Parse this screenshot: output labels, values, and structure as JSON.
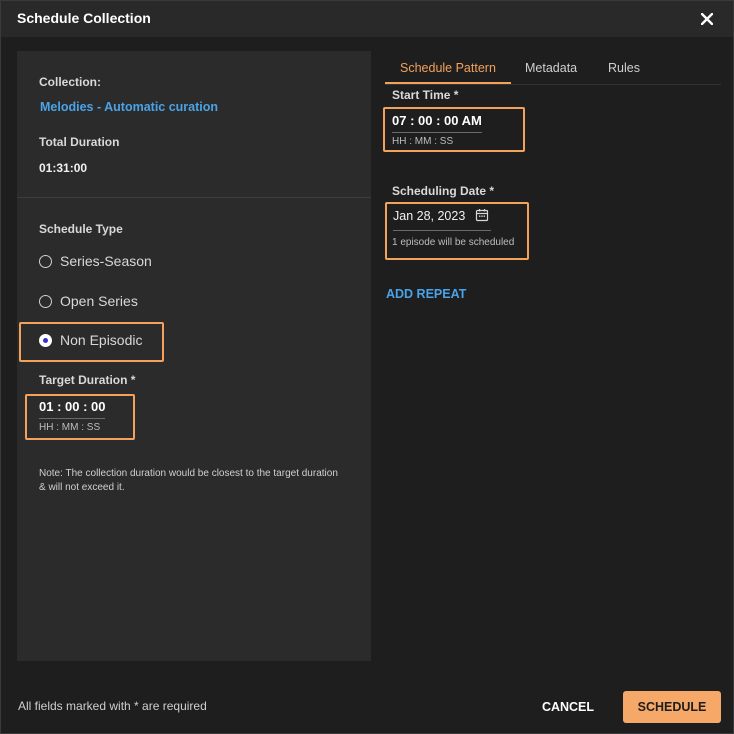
{
  "dialog": {
    "title": "Schedule Collection",
    "close_icon": "close-icon"
  },
  "left": {
    "collection_label": "Collection:",
    "collection_name": "Melodies - Automatic curation",
    "total_duration_label": "Total Duration",
    "total_duration_value": "01:31:00",
    "schedule_type_label": "Schedule Type",
    "schedule_types": [
      {
        "label": "Series-Season",
        "selected": false
      },
      {
        "label": "Open Series",
        "selected": false
      },
      {
        "label": "Non Episodic",
        "selected": true
      }
    ],
    "target_duration_label": "Target Duration *",
    "target_duration_value": "01 : 00 : 00",
    "target_duration_hint": "HH : MM : SS",
    "note": "Note: The collection duration would be closest to the target duration & will not exceed it."
  },
  "tabs": [
    {
      "label": "Schedule Pattern",
      "active": true
    },
    {
      "label": "Metadata",
      "active": false
    },
    {
      "label": "Rules",
      "active": false
    }
  ],
  "pattern": {
    "start_time_label": "Start Time *",
    "start_time_value": "07 : 00 : 00 AM",
    "start_time_hint": "HH : MM : SS",
    "scheduling_date_label": "Scheduling Date *",
    "scheduling_date_value": "Jan 28, 2023",
    "calendar_icon": "calendar-icon",
    "scheduling_hint": "1 episode will be scheduled",
    "add_repeat_label": "ADD REPEAT"
  },
  "footer": {
    "required_note": "All fields marked with * are required",
    "cancel_label": "CANCEL",
    "schedule_label": "SCHEDULE"
  },
  "colors": {
    "accent": "#f3a25c",
    "link": "#4aa3e8",
    "radio_selected": "#3a2dd8",
    "background": "#1e1e1e",
    "panel": "#2b2b2b"
  }
}
